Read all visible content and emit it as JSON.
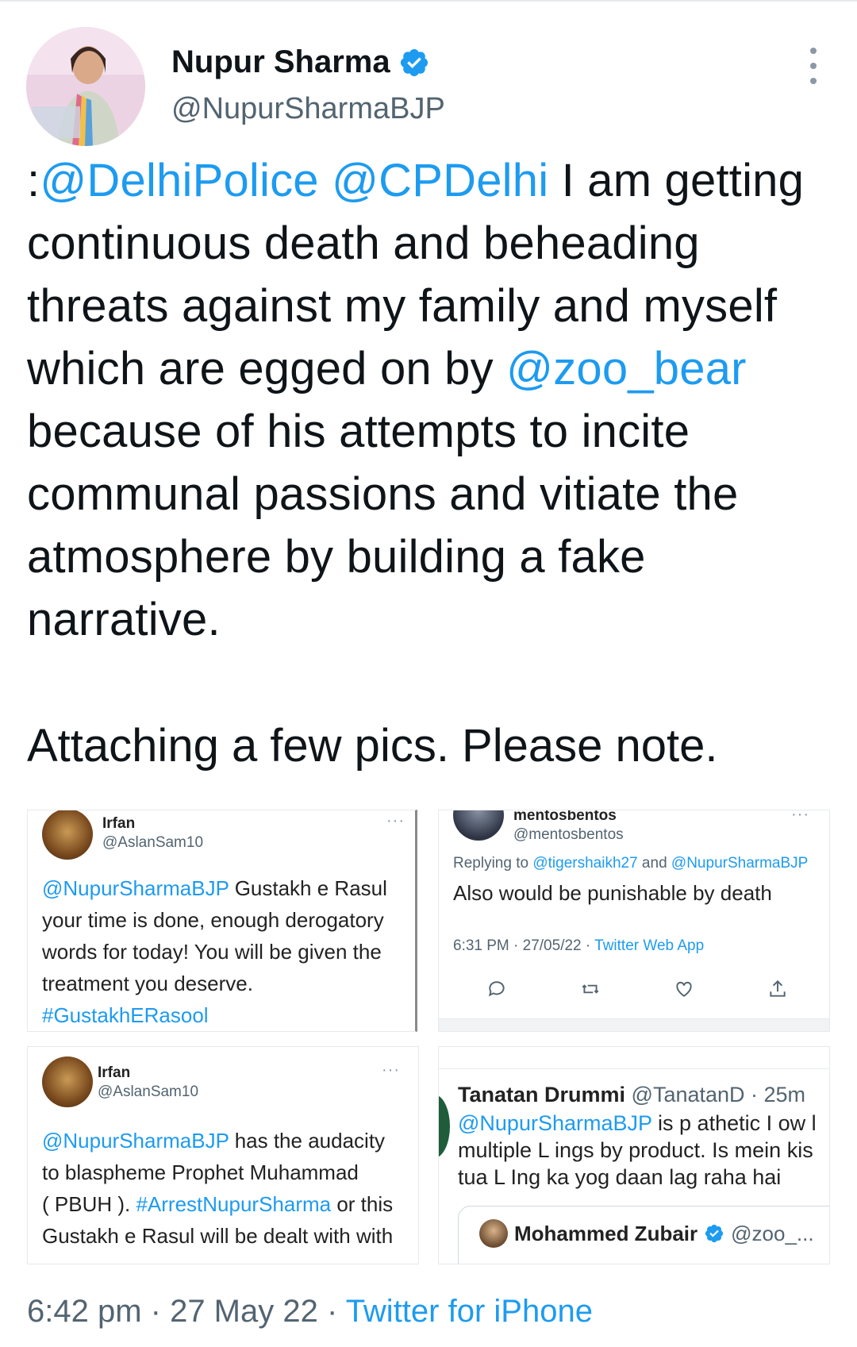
{
  "author": {
    "name": "Nupur Sharma",
    "handle": "@NupurSharmaBJP",
    "verified": true
  },
  "tweet": {
    "lines": [
      [
        {
          "t": ":",
          "link": false
        },
        {
          "t": "@DelhiPolice",
          "link": true
        },
        {
          "t": " ",
          "link": false
        },
        {
          "t": "@CPDelhi",
          "link": true
        },
        {
          "t": " I am getting",
          "link": false
        }
      ],
      [
        {
          "t": "continuous death and beheading",
          "link": false
        }
      ],
      [
        {
          "t": "threats against my family and myself",
          "link": false
        }
      ],
      [
        {
          "t": "which are egged on by ",
          "link": false
        },
        {
          "t": "@zoo_bear",
          "link": true
        }
      ],
      [
        {
          "t": "because of his attempts to incite",
          "link": false
        }
      ],
      [
        {
          "t": "communal passions and vitiate the",
          "link": false
        }
      ],
      [
        {
          "t": "atmosphere by building a fake",
          "link": false
        }
      ],
      [
        {
          "t": "narrative.",
          "link": false
        }
      ]
    ],
    "attaching": "Attaching a few pics. Please note."
  },
  "images": {
    "img1": {
      "name": "Irfan",
      "handle": "@AslanSam10",
      "dots": "···",
      "lines": [
        [
          {
            "t": "@NupurSharmaBJP",
            "link": true
          },
          {
            "t": " Gustakh e Rasul",
            "link": false
          }
        ],
        [
          {
            "t": "your time is done, enough derogatory",
            "link": false
          }
        ],
        [
          {
            "t": "words for today! You will be given the",
            "link": false
          }
        ],
        [
          {
            "t": "treatment you deserve.",
            "link": false
          }
        ],
        [
          {
            "t": "#GustakhERasool",
            "link": true
          }
        ]
      ]
    },
    "img2": {
      "name": "mentosbentos",
      "handle": "@mentosbentos",
      "dots": "···",
      "replying_prefix": "Replying to ",
      "replying_1": "@tigershaikh27",
      "replying_and": " and ",
      "replying_2": "@NupurSharmaBJP",
      "body": "Also would be punishable by death",
      "time": "6:31 PM · 27/05/22 · ",
      "source": "Twitter Web App"
    },
    "img3": {
      "name": "Irfan",
      "handle": "@AslanSam10",
      "dots": "···",
      "lines": [
        [
          {
            "t": "@NupurSharmaBJP",
            "link": true
          },
          {
            "t": " has the audacity",
            "link": false
          }
        ],
        [
          {
            "t": "to blaspheme Prophet Muhammad",
            "link": false
          }
        ],
        [
          {
            "t": "( PBUH ). ",
            "link": false
          },
          {
            "t": "#ArrestNupurSharma",
            "link": true
          },
          {
            "t": " or this",
            "link": false
          }
        ],
        [
          {
            "t": "Gustakh e Rasul will be dealt with with",
            "link": false
          }
        ]
      ]
    },
    "img4": {
      "author": "Tanatan Drummi",
      "handle_time": " @TanatanD · 25m",
      "mention": "@NupurSharmaBJP",
      "line1_rest": " is p athetic I ow l",
      "line2": "multiple L ings by product. Is mein kis",
      "line3": "tua L Ing ka yog daan lag raha hai",
      "quoted_name": "Mohammed Zubair",
      "quoted_handle": "@zoo_..."
    }
  },
  "footer": {
    "time": "6:42 pm · 27 May 22 · ",
    "source": "Twitter for iPhone"
  },
  "colors": {
    "link": "#1d9bf0",
    "secondary": "#536471",
    "text": "#0f1419"
  }
}
